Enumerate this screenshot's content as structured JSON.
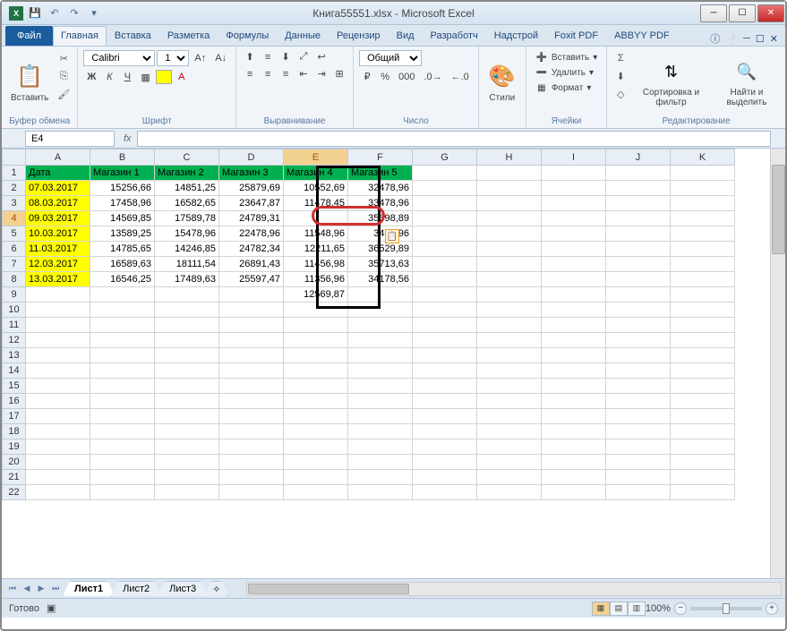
{
  "title": "Книга55551.xlsx - Microsoft Excel",
  "tabs": {
    "file": "Файл",
    "items": [
      "Главная",
      "Вставка",
      "Разметка",
      "Формулы",
      "Данные",
      "Рецензир",
      "Вид",
      "Разработч",
      "Надстрой",
      "Foxit PDF",
      "ABBYY PDF"
    ],
    "active": 0
  },
  "ribbon": {
    "clipboard": {
      "paste": "Вставить",
      "label": "Буфер обмена"
    },
    "font": {
      "name": "Calibri",
      "size": "11",
      "label": "Шрифт"
    },
    "align": {
      "label": "Выравнивание"
    },
    "number": {
      "format": "Общий",
      "label": "Число"
    },
    "styles": {
      "btn": "Стили",
      "label": ""
    },
    "cells": {
      "insert": "Вставить",
      "delete": "Удалить",
      "format": "Формат",
      "label": "Ячейки"
    },
    "editing": {
      "sort": "Сортировка и фильтр",
      "find": "Найти и выделить",
      "label": "Редактирование"
    }
  },
  "nameBox": "E4",
  "formula": "",
  "columns": [
    "A",
    "B",
    "C",
    "D",
    "E",
    "F",
    "G",
    "H",
    "I",
    "J",
    "K"
  ],
  "activeCol": 4,
  "activeRow": 4,
  "headers": [
    "Дата",
    "Магазин 1",
    "Магазин 2",
    "Магазин 3",
    "Магазин 4",
    "Магазин 5"
  ],
  "rows": [
    {
      "n": 2,
      "date": "07.03.2017",
      "v": [
        "15256,66",
        "14851,25",
        "25879,69",
        "10552,69",
        "32478,96"
      ]
    },
    {
      "n": 3,
      "date": "08.03.2017",
      "v": [
        "17458,96",
        "16582,65",
        "23647,87",
        "11478,45",
        "33478,96"
      ]
    },
    {
      "n": 4,
      "date": "09.03.2017",
      "v": [
        "14569,85",
        "17589,78",
        "24789,31",
        "",
        "35698,89"
      ]
    },
    {
      "n": 5,
      "date": "10.03.2017",
      "v": [
        "13589,25",
        "15478,96",
        "22478,96",
        "11548,96",
        "3478,96"
      ]
    },
    {
      "n": 6,
      "date": "11.03.2017",
      "v": [
        "14785,65",
        "14246,85",
        "24782,34",
        "12211,65",
        "36529,89"
      ]
    },
    {
      "n": 7,
      "date": "12.03.2017",
      "v": [
        "16589,63",
        "18111,54",
        "26891,43",
        "11456,98",
        "35713,63"
      ]
    },
    {
      "n": 8,
      "date": "13.03.2017",
      "v": [
        "16546,25",
        "17489,63",
        "25597,47",
        "11356,96",
        "34178,56"
      ]
    },
    {
      "n": 9,
      "date": "",
      "v": [
        "",
        "",
        "",
        "12569,87",
        ""
      ]
    }
  ],
  "emptyRows": [
    10,
    11,
    12,
    13,
    14,
    15,
    16,
    17,
    18,
    19,
    20,
    21,
    22
  ],
  "sheets": [
    "Лист1",
    "Лист2",
    "Лист3"
  ],
  "activeSheet": 0,
  "status": "Готово",
  "zoom": "100%"
}
